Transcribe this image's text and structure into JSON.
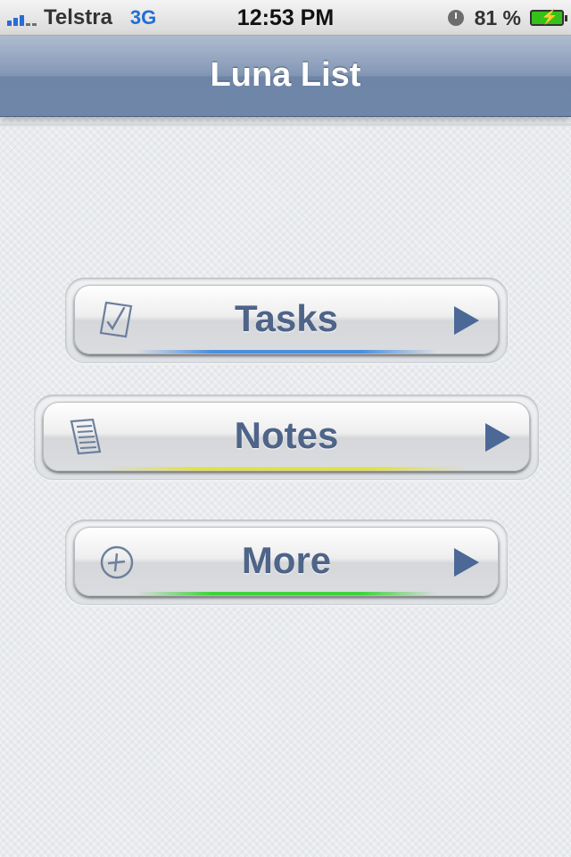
{
  "status_bar": {
    "carrier": "Telstra",
    "network": "3G",
    "time": "12:53 PM",
    "battery": "81 %",
    "icons": [
      "signal-icon",
      "clock-icon",
      "battery-charging-icon"
    ]
  },
  "navbar": {
    "title": "Luna List"
  },
  "menu": {
    "tasks": {
      "label": "Tasks",
      "glow_color": "#4a8fe0",
      "icon": "checklist-pencil-icon"
    },
    "notes": {
      "label": "Notes",
      "glow_color": "#e6e23a",
      "icon": "note-page-icon"
    },
    "more": {
      "label": "More",
      "glow_color": "#3fd33b",
      "icon": "plus-circle-icon"
    }
  },
  "colors": {
    "nav_bar": "#7a8fae",
    "button_label": "#4e6488",
    "arrow": "#4b6897"
  }
}
